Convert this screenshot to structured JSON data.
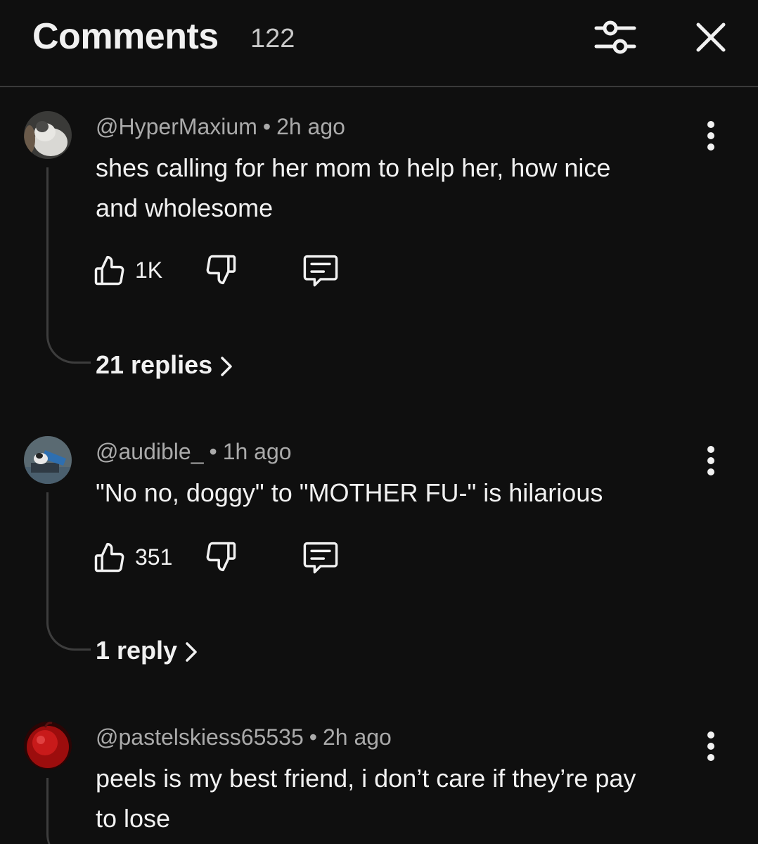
{
  "header": {
    "title": "Comments",
    "count": "122"
  },
  "comments": [
    {
      "author": "@HyperMaxium",
      "separator": "•",
      "time": "2h ago",
      "text_line1": "shes calling for her mom to help her, how nice",
      "text_line2": "and wholesome",
      "likes": "1K",
      "replies": "21 replies"
    },
    {
      "author": "@audible_",
      "separator": "•",
      "time": "1h ago",
      "text_line1": "\"No no, doggy\" to \"MOTHER FU-\" is hilarious",
      "likes": "351",
      "replies": "1 reply"
    },
    {
      "author": "@pastelskiess65535",
      "separator": "•",
      "time": "2h ago",
      "text_line1": "peels is my best friend, i don’t care if they’re pay",
      "text_line2": "to lose"
    }
  ],
  "icons": {
    "filter": "sliders-icon",
    "close": "close-icon",
    "more": "more-vertical-icon",
    "like": "thumbs-up-icon",
    "dislike": "thumbs-down-icon",
    "reply": "comment-icon",
    "chevron": "chevron-right-icon"
  },
  "colors": {
    "background": "#0f0f0f",
    "text": "#f1f1f1",
    "secondary_text": "#aaaaaa",
    "divider": "#3a3a3a"
  }
}
